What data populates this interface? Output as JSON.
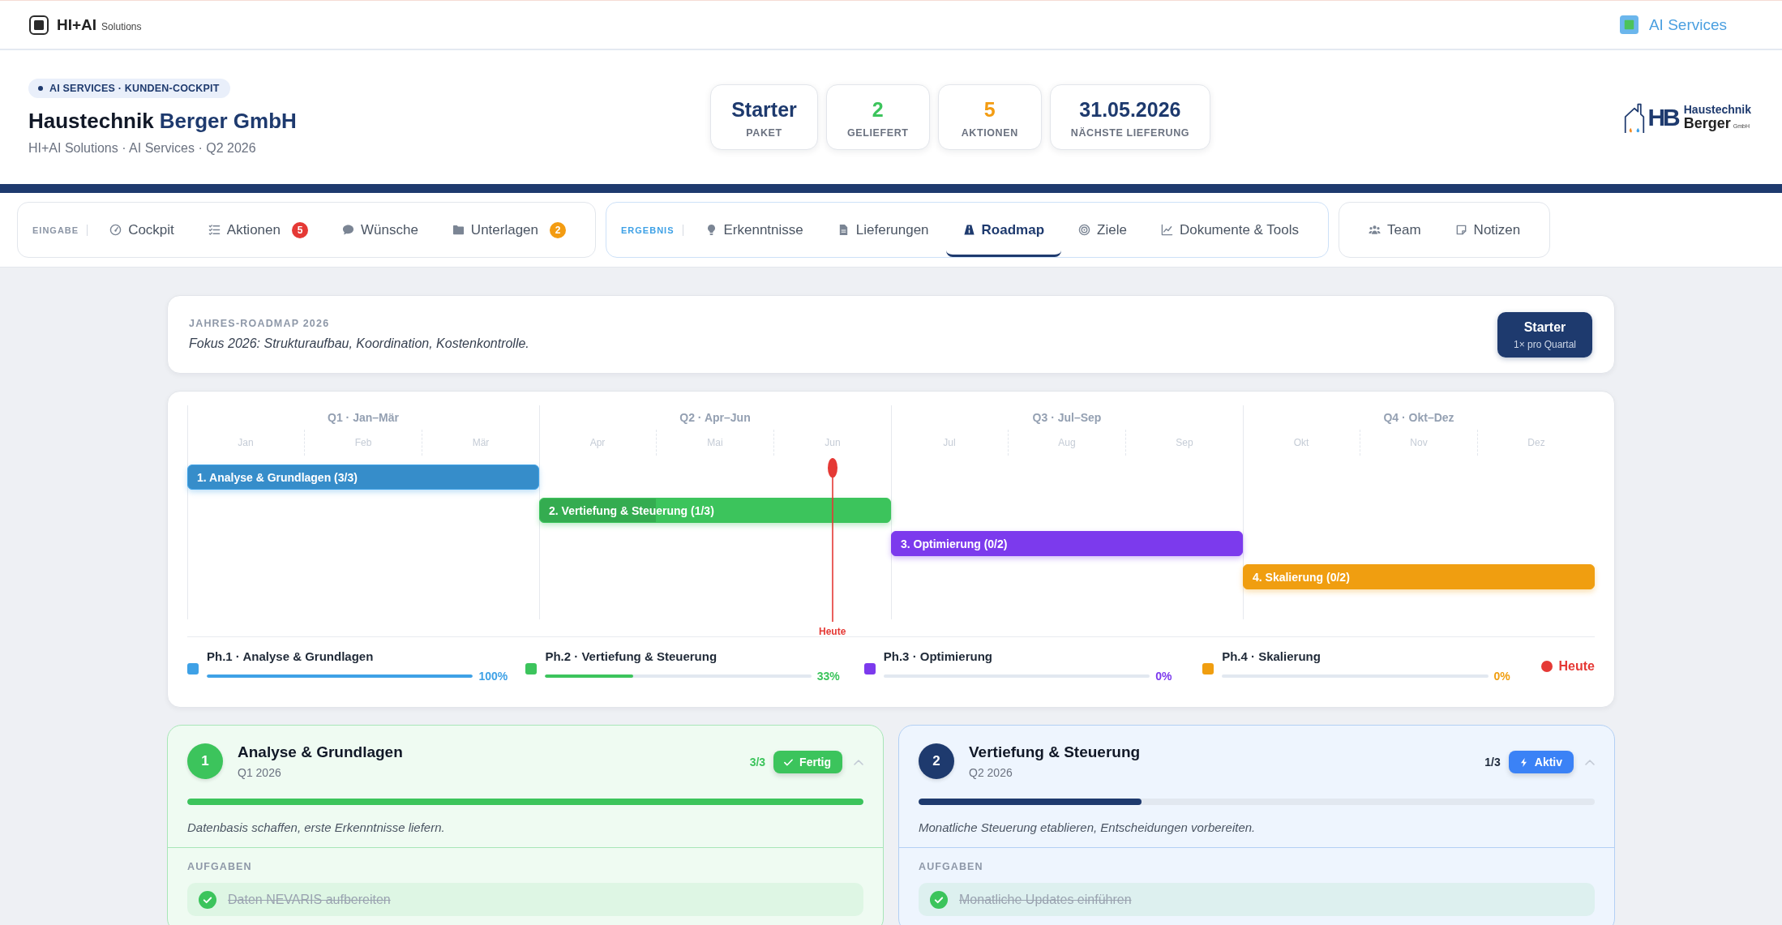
{
  "topbar": {
    "brand": "HI+AI",
    "brand_sub": "Solutions",
    "service_link": "AI Services"
  },
  "header": {
    "badge": "AI SERVICES · KUNDEN-COCKPIT",
    "company": "Haustechnik",
    "company_accent": "Berger GmbH",
    "subtitle": "HI+AI Solutions · AI Services · Q2 2026",
    "stats": [
      {
        "value": "Starter",
        "label": "PAKET",
        "color": "#1e3a6e"
      },
      {
        "value": "2",
        "label": "GELIEFERT",
        "color": "#3cc45c"
      },
      {
        "value": "5",
        "label": "AKTIONEN",
        "color": "#f39c12"
      },
      {
        "value": "31.05.2026",
        "label": "NÄCHSTE LIEFERUNG",
        "color": "#1e3a6e"
      }
    ],
    "logo": {
      "monogram": "HB",
      "line1": "Haustechnik",
      "line2": "Berger",
      "suffix": "GmbH"
    }
  },
  "nav": {
    "groups": [
      {
        "label": "EINGABE",
        "tabs": [
          {
            "label": "Cockpit",
            "selected": false
          },
          {
            "label": "Aktionen",
            "selected": false,
            "badge": {
              "text": "5",
              "color": "#e53935"
            }
          },
          {
            "label": "Wünsche",
            "selected": false
          },
          {
            "label": "Unterlagen",
            "selected": false,
            "badge": {
              "text": "2",
              "color": "#f39c12"
            }
          }
        ]
      },
      {
        "label": "ERGEBNIS",
        "tabs": [
          {
            "label": "Erkenntnisse",
            "selected": false
          },
          {
            "label": "Lieferungen",
            "selected": false
          },
          {
            "label": "Roadmap",
            "selected": true
          },
          {
            "label": "Ziele",
            "selected": false
          },
          {
            "label": "Dokumente & Tools",
            "selected": false
          }
        ]
      },
      {
        "tabs": [
          {
            "label": "Team",
            "selected": false
          },
          {
            "label": "Notizen",
            "selected": false
          }
        ]
      }
    ]
  },
  "roadmap": {
    "title": "JAHRES-ROADMAP 2026",
    "focus": "Fokus 2026: Strukturaufbau, Koordination, Kostenkontrolle.",
    "package": {
      "name": "Starter",
      "frequency": "1× pro Quartal"
    }
  },
  "timeline": {
    "quarters": [
      {
        "label": "Q1 · Jan–Mär",
        "months": [
          {
            "label": "Jan",
            "today": false
          },
          {
            "label": "Feb",
            "today": false
          },
          {
            "label": "Mär",
            "today": false
          }
        ],
        "bar": {
          "label": "1. Analyse & Grundlagen (3/3)",
          "color": "#3ea1e6",
          "level": 1
        }
      },
      {
        "label": "Q2 · Apr–Jun",
        "months": [
          {
            "label": "Apr",
            "today": false
          },
          {
            "label": "Mai",
            "today": false
          },
          {
            "label": "Jun",
            "today": true
          }
        ],
        "bar": {
          "label": "2. Vertiefung & Steuerung (1/3)",
          "color": "#3cc45c",
          "level": 0.33
        }
      },
      {
        "label": "Q3 · Jul–Sep",
        "months": [
          {
            "label": "Jul",
            "today": false
          },
          {
            "label": "Aug",
            "today": false
          },
          {
            "label": "Sep",
            "today": false
          }
        ],
        "bar": {
          "label": "3. Optimierung (0/2)",
          "color": "#7c3aed",
          "level": 0
        }
      },
      {
        "label": "Q4 · Okt–Dez",
        "months": [
          {
            "label": "Okt",
            "today": false
          },
          {
            "label": "Nov",
            "today": false
          },
          {
            "label": "Dez",
            "today": false
          }
        ],
        "bar": {
          "label": "4. Skalierung (0/2)",
          "color": "#f09e10",
          "level": 0
        }
      }
    ],
    "today_label": "Heute",
    "legend": [
      {
        "label": "Ph.1 · Analyse & Grundlagen",
        "color": "#3ea1e6",
        "level": 1,
        "percent": "100%"
      },
      {
        "label": "Ph.2 · Vertiefung & Steuerung",
        "color": "#3cc45c",
        "level": 0.33,
        "percent": "33%"
      },
      {
        "label": "Ph.3 · Optimierung",
        "color": "#7c3aed",
        "level": 0,
        "percent": "0%"
      },
      {
        "label": "Ph.4 · Skalierung",
        "color": "#f09e10",
        "level": 0,
        "percent": "0%"
      }
    ],
    "today_legend": "Heute"
  },
  "phases": [
    {
      "number": "1",
      "title": "Analyse & Grundlagen",
      "period": "Q1 2026",
      "count": "3/3",
      "kind": "done",
      "status_label": "Fertig",
      "expanded": true,
      "level": 1,
      "description": "Datenbasis schaffen, erste Erkenntnisse liefern.",
      "tasks_heading": "AUFGABEN",
      "tasks": [
        {
          "label": "Daten NEVARIS aufbereiten",
          "done": true
        }
      ]
    },
    {
      "number": "2",
      "title": "Vertiefung & Steuerung",
      "period": "Q2 2026",
      "count": "1/3",
      "kind": "active",
      "status_label": "Aktiv",
      "expanded": true,
      "level": 0.33,
      "description": "Monatliche Steuerung etablieren, Entscheidungen vorbereiten.",
      "tasks_heading": "AUFGABEN",
      "tasks": [
        {
          "label": "Monatliche Updates einführen",
          "done": true
        }
      ]
    }
  ]
}
